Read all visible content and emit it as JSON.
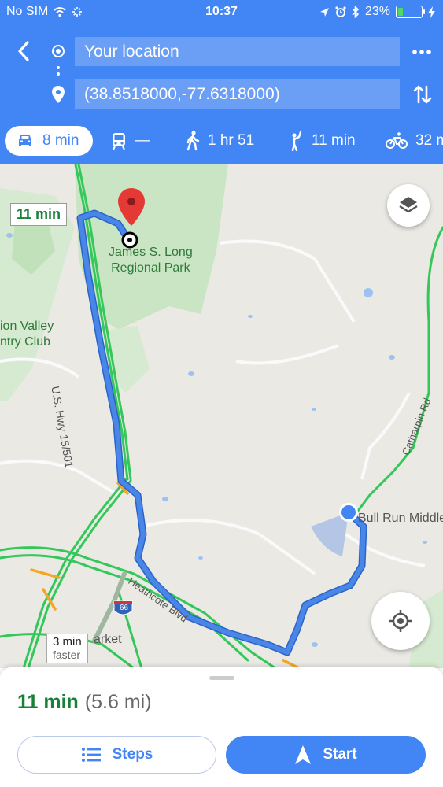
{
  "status_bar": {
    "carrier": "No SIM",
    "time": "10:37",
    "battery": "23%",
    "battery_level": 0.23,
    "icons": [
      "wifi-icon",
      "activity-icon",
      "location-arrow-icon",
      "alarm-icon",
      "bluetooth-icon",
      "battery-icon",
      "charging-icon"
    ]
  },
  "directions": {
    "origin": "Your location",
    "destination": "(38.8518000,-77.6318000)"
  },
  "modes": [
    {
      "id": "drive",
      "icon": "car-icon",
      "label": "8 min",
      "active": true
    },
    {
      "id": "transit",
      "icon": "train-icon",
      "label": "—"
    },
    {
      "id": "walk",
      "icon": "walking-icon",
      "label": "1 hr 51"
    },
    {
      "id": "ride",
      "icon": "hail-icon",
      "label": "11 min"
    },
    {
      "id": "bike",
      "icon": "bicycle-icon",
      "label": "32 m"
    }
  ],
  "map": {
    "route_chip": "11 min",
    "faster_chip": {
      "time": "3 min",
      "note": "faster"
    },
    "labels": {
      "park": [
        "James S. Long",
        "Regional Park"
      ],
      "club": [
        "ion Valley",
        "ntry Club"
      ],
      "highway": "U.S. Hwy 15/501",
      "heathcote": "Heathcote Blvd",
      "catharpin": "Catharpin Rd",
      "school": "Bull Run Middle",
      "market": "arket",
      "interstate": "66"
    },
    "colors": {
      "route": "#4a86e8",
      "park": "#c5e3bf",
      "traffic_green": "#34c759",
      "traffic_orange": "#f5a623"
    }
  },
  "bottom_sheet": {
    "duration": "11 min",
    "distance": "(5.6 mi)",
    "steps_label": "Steps",
    "start_label": "Start"
  }
}
